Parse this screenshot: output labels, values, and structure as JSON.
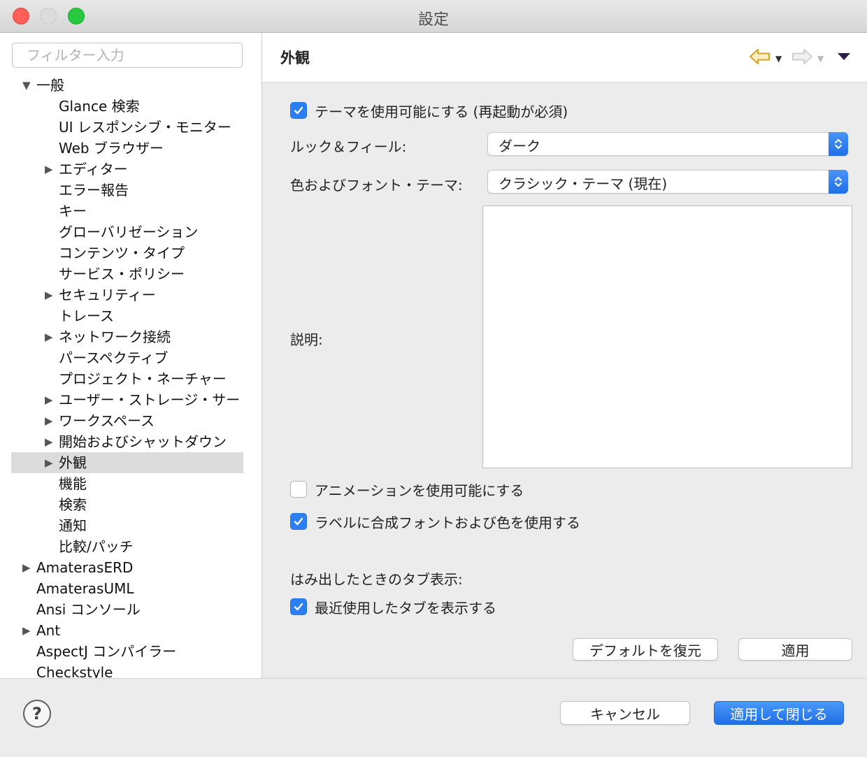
{
  "window": {
    "title": "設定"
  },
  "sidebar": {
    "filter_placeholder": "フィルター入力",
    "items": [
      {
        "label": "一般",
        "level": 0,
        "twisty": "▼"
      },
      {
        "label": "Glance 検索",
        "level": 1,
        "twisty": ""
      },
      {
        "label": "UI レスポンシブ・モニター",
        "level": 1,
        "twisty": ""
      },
      {
        "label": "Web ブラウザー",
        "level": 1,
        "twisty": ""
      },
      {
        "label": "エディター",
        "level": 1,
        "twisty": "▶"
      },
      {
        "label": "エラー報告",
        "level": 1,
        "twisty": ""
      },
      {
        "label": "キー",
        "level": 1,
        "twisty": ""
      },
      {
        "label": "グローバリゼーション",
        "level": 1,
        "twisty": ""
      },
      {
        "label": "コンテンツ・タイプ",
        "level": 1,
        "twisty": ""
      },
      {
        "label": "サービス・ポリシー",
        "level": 1,
        "twisty": ""
      },
      {
        "label": "セキュリティー",
        "level": 1,
        "twisty": "▶"
      },
      {
        "label": "トレース",
        "level": 1,
        "twisty": ""
      },
      {
        "label": "ネットワーク接続",
        "level": 1,
        "twisty": "▶"
      },
      {
        "label": "パースペクティブ",
        "level": 1,
        "twisty": ""
      },
      {
        "label": "プロジェクト・ネーチャー",
        "level": 1,
        "twisty": ""
      },
      {
        "label": "ユーザー・ストレージ・サー",
        "level": 1,
        "twisty": "▶"
      },
      {
        "label": "ワークスペース",
        "level": 1,
        "twisty": "▶"
      },
      {
        "label": "開始およびシャットダウン",
        "level": 1,
        "twisty": "▶"
      },
      {
        "label": "外観",
        "level": 1,
        "twisty": "▶",
        "selected": true
      },
      {
        "label": "機能",
        "level": 1,
        "twisty": ""
      },
      {
        "label": "検索",
        "level": 1,
        "twisty": ""
      },
      {
        "label": "通知",
        "level": 1,
        "twisty": ""
      },
      {
        "label": "比較/パッチ",
        "level": 1,
        "twisty": ""
      },
      {
        "label": "AmaterasERD",
        "level": 0,
        "twisty": "▶"
      },
      {
        "label": "AmaterasUML",
        "level": 0,
        "twisty": ""
      },
      {
        "label": "Ansi コンソール",
        "level": 0,
        "twisty": ""
      },
      {
        "label": "Ant",
        "level": 0,
        "twisty": "▶"
      },
      {
        "label": "AspectJ コンパイラー",
        "level": 0,
        "twisty": ""
      },
      {
        "label": "Checkstyle",
        "level": 0,
        "twisty": ""
      }
    ]
  },
  "main": {
    "title": "外観",
    "enable_theming": {
      "label": "テーマを使用可能にする (再起動が必須)",
      "checked": true
    },
    "look_feel": {
      "label": "ルック＆フィール:",
      "value": "ダーク"
    },
    "color_font_theme": {
      "label": "色およびフォント・テーマ:",
      "value": "クラシック・テーマ (現在)"
    },
    "description": {
      "label": "説明:"
    },
    "enable_animations": {
      "label": "アニメーションを使用可能にする",
      "checked": false
    },
    "mixed_fonts": {
      "label": "ラベルに合成フォントおよび色を使用する",
      "checked": true
    },
    "tab_overflow_label": "はみ出したときのタブ表示:",
    "recent_tabs": {
      "label": "最近使用したタブを表示する",
      "checked": true
    },
    "restore_defaults_label": "デフォルトを復元",
    "apply_label": "適用"
  },
  "footer": {
    "help_symbol": "?",
    "cancel_label": "キャンセル",
    "apply_close_label": "適用して閉じる"
  },
  "colors": {
    "accent": "#2b7ff3",
    "selection": "#dcdcdc",
    "nav_back": "#d9a126",
    "close": "#fe5f57",
    "maximize": "#28c840"
  }
}
